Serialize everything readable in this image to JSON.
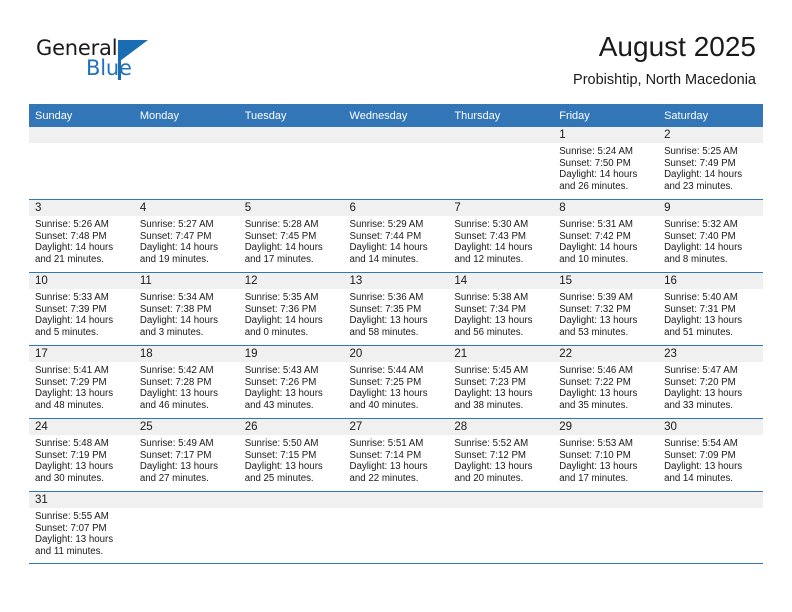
{
  "brand": {
    "name_part1": "General",
    "name_part2": "Blue"
  },
  "header": {
    "month_title": "August 2025",
    "location": "Probishtip, North Macedonia"
  },
  "colors": {
    "header_blue": "#3276b8",
    "band_gray": "#f0f0f0",
    "logo_blue": "#2272b8",
    "text": "#1a1a1a"
  },
  "calendar": {
    "weekdays": [
      "Sunday",
      "Monday",
      "Tuesday",
      "Wednesday",
      "Thursday",
      "Friday",
      "Saturday"
    ],
    "weeks": [
      [
        {
          "day": "",
          "lines": []
        },
        {
          "day": "",
          "lines": []
        },
        {
          "day": "",
          "lines": []
        },
        {
          "day": "",
          "lines": []
        },
        {
          "day": "",
          "lines": []
        },
        {
          "day": "1",
          "lines": [
            "Sunrise: 5:24 AM",
            "Sunset: 7:50 PM",
            "Daylight: 14 hours",
            "and 26 minutes."
          ]
        },
        {
          "day": "2",
          "lines": [
            "Sunrise: 5:25 AM",
            "Sunset: 7:49 PM",
            "Daylight: 14 hours",
            "and 23 minutes."
          ]
        }
      ],
      [
        {
          "day": "3",
          "lines": [
            "Sunrise: 5:26 AM",
            "Sunset: 7:48 PM",
            "Daylight: 14 hours",
            "and 21 minutes."
          ]
        },
        {
          "day": "4",
          "lines": [
            "Sunrise: 5:27 AM",
            "Sunset: 7:47 PM",
            "Daylight: 14 hours",
            "and 19 minutes."
          ]
        },
        {
          "day": "5",
          "lines": [
            "Sunrise: 5:28 AM",
            "Sunset: 7:45 PM",
            "Daylight: 14 hours",
            "and 17 minutes."
          ]
        },
        {
          "day": "6",
          "lines": [
            "Sunrise: 5:29 AM",
            "Sunset: 7:44 PM",
            "Daylight: 14 hours",
            "and 14 minutes."
          ]
        },
        {
          "day": "7",
          "lines": [
            "Sunrise: 5:30 AM",
            "Sunset: 7:43 PM",
            "Daylight: 14 hours",
            "and 12 minutes."
          ]
        },
        {
          "day": "8",
          "lines": [
            "Sunrise: 5:31 AM",
            "Sunset: 7:42 PM",
            "Daylight: 14 hours",
            "and 10 minutes."
          ]
        },
        {
          "day": "9",
          "lines": [
            "Sunrise: 5:32 AM",
            "Sunset: 7:40 PM",
            "Daylight: 14 hours",
            "and 8 minutes."
          ]
        }
      ],
      [
        {
          "day": "10",
          "lines": [
            "Sunrise: 5:33 AM",
            "Sunset: 7:39 PM",
            "Daylight: 14 hours",
            "and 5 minutes."
          ]
        },
        {
          "day": "11",
          "lines": [
            "Sunrise: 5:34 AM",
            "Sunset: 7:38 PM",
            "Daylight: 14 hours",
            "and 3 minutes."
          ]
        },
        {
          "day": "12",
          "lines": [
            "Sunrise: 5:35 AM",
            "Sunset: 7:36 PM",
            "Daylight: 14 hours",
            "and 0 minutes."
          ]
        },
        {
          "day": "13",
          "lines": [
            "Sunrise: 5:36 AM",
            "Sunset: 7:35 PM",
            "Daylight: 13 hours",
            "and 58 minutes."
          ]
        },
        {
          "day": "14",
          "lines": [
            "Sunrise: 5:38 AM",
            "Sunset: 7:34 PM",
            "Daylight: 13 hours",
            "and 56 minutes."
          ]
        },
        {
          "day": "15",
          "lines": [
            "Sunrise: 5:39 AM",
            "Sunset: 7:32 PM",
            "Daylight: 13 hours",
            "and 53 minutes."
          ]
        },
        {
          "day": "16",
          "lines": [
            "Sunrise: 5:40 AM",
            "Sunset: 7:31 PM",
            "Daylight: 13 hours",
            "and 51 minutes."
          ]
        }
      ],
      [
        {
          "day": "17",
          "lines": [
            "Sunrise: 5:41 AM",
            "Sunset: 7:29 PM",
            "Daylight: 13 hours",
            "and 48 minutes."
          ]
        },
        {
          "day": "18",
          "lines": [
            "Sunrise: 5:42 AM",
            "Sunset: 7:28 PM",
            "Daylight: 13 hours",
            "and 46 minutes."
          ]
        },
        {
          "day": "19",
          "lines": [
            "Sunrise: 5:43 AM",
            "Sunset: 7:26 PM",
            "Daylight: 13 hours",
            "and 43 minutes."
          ]
        },
        {
          "day": "20",
          "lines": [
            "Sunrise: 5:44 AM",
            "Sunset: 7:25 PM",
            "Daylight: 13 hours",
            "and 40 minutes."
          ]
        },
        {
          "day": "21",
          "lines": [
            "Sunrise: 5:45 AM",
            "Sunset: 7:23 PM",
            "Daylight: 13 hours",
            "and 38 minutes."
          ]
        },
        {
          "day": "22",
          "lines": [
            "Sunrise: 5:46 AM",
            "Sunset: 7:22 PM",
            "Daylight: 13 hours",
            "and 35 minutes."
          ]
        },
        {
          "day": "23",
          "lines": [
            "Sunrise: 5:47 AM",
            "Sunset: 7:20 PM",
            "Daylight: 13 hours",
            "and 33 minutes."
          ]
        }
      ],
      [
        {
          "day": "24",
          "lines": [
            "Sunrise: 5:48 AM",
            "Sunset: 7:19 PM",
            "Daylight: 13 hours",
            "and 30 minutes."
          ]
        },
        {
          "day": "25",
          "lines": [
            "Sunrise: 5:49 AM",
            "Sunset: 7:17 PM",
            "Daylight: 13 hours",
            "and 27 minutes."
          ]
        },
        {
          "day": "26",
          "lines": [
            "Sunrise: 5:50 AM",
            "Sunset: 7:15 PM",
            "Daylight: 13 hours",
            "and 25 minutes."
          ]
        },
        {
          "day": "27",
          "lines": [
            "Sunrise: 5:51 AM",
            "Sunset: 7:14 PM",
            "Daylight: 13 hours",
            "and 22 minutes."
          ]
        },
        {
          "day": "28",
          "lines": [
            "Sunrise: 5:52 AM",
            "Sunset: 7:12 PM",
            "Daylight: 13 hours",
            "and 20 minutes."
          ]
        },
        {
          "day": "29",
          "lines": [
            "Sunrise: 5:53 AM",
            "Sunset: 7:10 PM",
            "Daylight: 13 hours",
            "and 17 minutes."
          ]
        },
        {
          "day": "30",
          "lines": [
            "Sunrise: 5:54 AM",
            "Sunset: 7:09 PM",
            "Daylight: 13 hours",
            "and 14 minutes."
          ]
        }
      ],
      [
        {
          "day": "31",
          "lines": [
            "Sunrise: 5:55 AM",
            "Sunset: 7:07 PM",
            "Daylight: 13 hours",
            "and 11 minutes."
          ]
        },
        {
          "day": "",
          "lines": []
        },
        {
          "day": "",
          "lines": []
        },
        {
          "day": "",
          "lines": []
        },
        {
          "day": "",
          "lines": []
        },
        {
          "day": "",
          "lines": []
        },
        {
          "day": "",
          "lines": []
        }
      ]
    ]
  }
}
